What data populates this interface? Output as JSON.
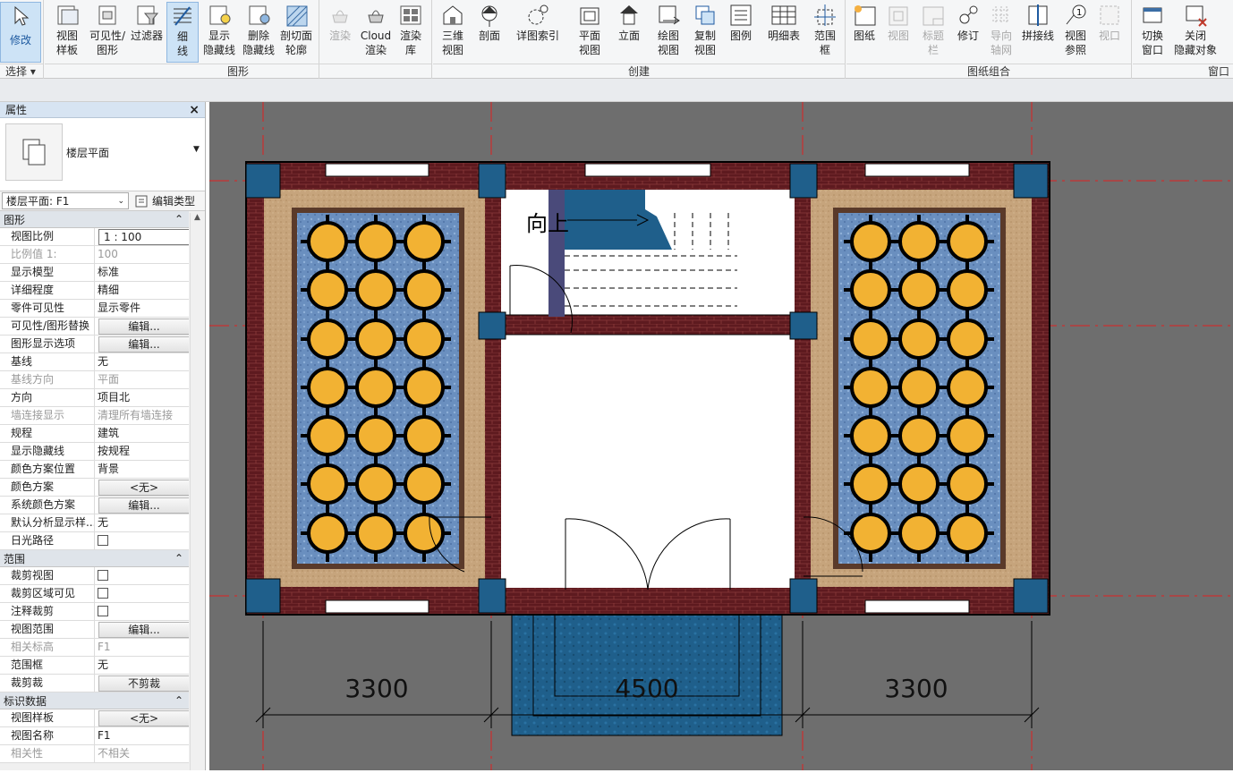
{
  "ribbon": {
    "buttons": [
      {
        "label": "修改",
        "icon": "modify-icon"
      },
      {
        "label": "视图\n样板",
        "icon": "view-template-icon"
      },
      {
        "label": "可见性/\n图形",
        "icon": "visibility-graphics-icon"
      },
      {
        "label": "过滤器",
        "icon": "filter-icon"
      },
      {
        "label": "细\n线",
        "icon": "thin-lines-icon"
      },
      {
        "label": "显示\n隐藏线",
        "icon": "show-hidden-lines-icon"
      },
      {
        "label": "删除\n隐藏线",
        "icon": "remove-hidden-lines-icon"
      },
      {
        "label": "剖切面\n轮廓",
        "icon": "cut-profile-icon"
      },
      {
        "label": "渲染",
        "icon": "render-icon"
      },
      {
        "label": "Cloud\n渲染",
        "icon": "cloud-render-icon"
      },
      {
        "label": "渲染\n库",
        "icon": "render-gallery-icon"
      },
      {
        "label": "三维\n视图",
        "icon": "3d-view-icon"
      },
      {
        "label": "剖面",
        "icon": "section-icon"
      },
      {
        "label": "详图索引",
        "icon": "callout-icon"
      },
      {
        "label": "平面\n视图",
        "icon": "plan-view-icon"
      },
      {
        "label": "立面",
        "icon": "elevation-icon"
      },
      {
        "label": "绘图\n视图",
        "icon": "drafting-view-icon"
      },
      {
        "label": "复制\n视图",
        "icon": "duplicate-view-icon"
      },
      {
        "label": "图例",
        "icon": "legend-icon"
      },
      {
        "label": "明细表",
        "icon": "schedule-icon"
      },
      {
        "label": "范围\n框",
        "icon": "scope-box-icon"
      },
      {
        "label": "图纸",
        "icon": "sheet-icon"
      },
      {
        "label": "视图",
        "icon": "view-icon"
      },
      {
        "label": "标题\n栏",
        "icon": "title-block-icon"
      },
      {
        "label": "修订",
        "icon": "revision-icon"
      },
      {
        "label": "导向\n轴网",
        "icon": "guide-grid-icon"
      },
      {
        "label": "拼接线",
        "icon": "matchline-icon"
      },
      {
        "label": "视图\n参照",
        "icon": "view-reference-icon"
      },
      {
        "label": "视口",
        "icon": "viewport-icon"
      },
      {
        "label": "切换\n窗口",
        "icon": "switch-windows-icon"
      },
      {
        "label": "关闭\n隐藏对象",
        "icon": "close-hidden-icon"
      }
    ],
    "groups": [
      "选择",
      "图形",
      "创建",
      "图纸组合",
      "窗口"
    ]
  },
  "properties": {
    "title": "属性",
    "type_name": "楼层平面",
    "selector": "楼层平面: F1",
    "edit_type": "编辑类型",
    "categories": [
      {
        "name": "图形",
        "rows": [
          {
            "k": "视图比例",
            "v": "1 : 100",
            "t": "input"
          },
          {
            "k": "比例值 1:",
            "v": "100",
            "t": "gray"
          },
          {
            "k": "显示模型",
            "v": "标准"
          },
          {
            "k": "详细程度",
            "v": "精细"
          },
          {
            "k": "零件可见性",
            "v": "显示零件"
          },
          {
            "k": "可见性/图形替换",
            "v": "编辑...",
            "t": "button"
          },
          {
            "k": "图形显示选项",
            "v": "编辑...",
            "t": "button"
          },
          {
            "k": "基线",
            "v": "无"
          },
          {
            "k": "基线方向",
            "v": "平面",
            "t": "gray"
          },
          {
            "k": "方向",
            "v": "项目北"
          },
          {
            "k": "墙连接显示",
            "v": "清理所有墙连接",
            "t": "gray"
          },
          {
            "k": "规程",
            "v": "建筑"
          },
          {
            "k": "显示隐藏线",
            "v": "按规程"
          },
          {
            "k": "颜色方案位置",
            "v": "背景"
          },
          {
            "k": "颜色方案",
            "v": "<无>",
            "t": "button"
          },
          {
            "k": "系统颜色方案",
            "v": "编辑...",
            "t": "button"
          },
          {
            "k": "默认分析显示样...",
            "v": "无"
          },
          {
            "k": "日光路径",
            "v": "",
            "t": "check"
          }
        ]
      },
      {
        "name": "范围",
        "rows": [
          {
            "k": "裁剪视图",
            "v": "",
            "t": "check"
          },
          {
            "k": "裁剪区域可见",
            "v": "",
            "t": "check"
          },
          {
            "k": "注释裁剪",
            "v": "",
            "t": "check"
          },
          {
            "k": "视图范围",
            "v": "编辑...",
            "t": "button"
          },
          {
            "k": "相关标高",
            "v": "F1",
            "t": "gray"
          },
          {
            "k": "范围框",
            "v": "无"
          },
          {
            "k": "裁剪裁",
            "v": "不剪裁",
            "t": "button"
          }
        ]
      },
      {
        "name": "标识数据",
        "rows": [
          {
            "k": "视图样板",
            "v": "<无>",
            "t": "button"
          },
          {
            "k": "视图名称",
            "v": "F1"
          },
          {
            "k": "相关性",
            "v": "不相关",
            "t": "gray"
          }
        ]
      }
    ]
  },
  "drawing": {
    "stair_label": "向上",
    "dimensions": [
      "3300",
      "4500",
      "3300"
    ]
  }
}
